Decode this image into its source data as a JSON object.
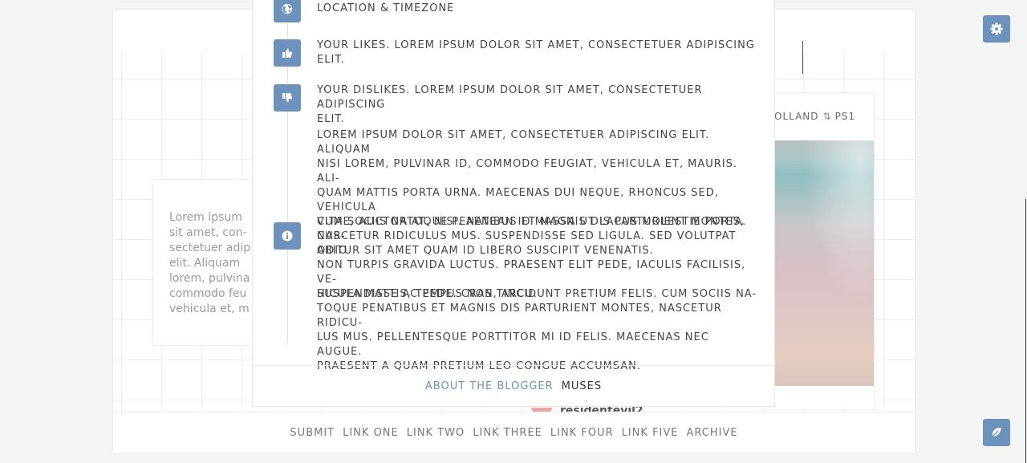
{
  "colors": {
    "accent": "#6d93bd",
    "text": "#444444",
    "muted": "#777777"
  },
  "background_card": {
    "text": "Lorem ipsum\nsit amet, con-\nsectetuer adip\nelit. Aliquam\nlorem, pulvina\ncommodo feu\nvehicula et, m"
  },
  "post": {
    "meta_location": "OLLAND",
    "meta_reblog_icon": "reblog-icon",
    "meta_source": "PS1",
    "username_fragment": "residentevil2"
  },
  "footer_nav": {
    "links": [
      "SUBMIT",
      "LINK ONE",
      "LINK TWO",
      "LINK THREE",
      "LINK FOUR",
      "LINK FIVE",
      "ARCHIVE"
    ]
  },
  "buttons": {
    "settings_icon": "gear-icon",
    "compose_icon": "leaf-icon"
  },
  "about_modal": {
    "sections": [
      {
        "icon": "globe-icon",
        "text": "LOCATION & TIMEZONE"
      },
      {
        "icon": "thumbs-up-icon",
        "text": "YOUR LIKES. LOREM IPSUM DOLOR SIT AMET, CONSECTETUER ADIPISCING\nELIT."
      },
      {
        "icon": "thumbs-down-icon",
        "text": "YOUR DISLIKES. LOREM IPSUM DOLOR SIT AMET, CONSECTETUER ADIPISCING\nELIT."
      },
      {
        "icon": "",
        "text": "LOREM IPSUM DOLOR SIT AMET, CONSECTETUER ADIPISCING ELIT. ALIQUAM\nNISI LOREM, PULVINAR ID, COMMODO FEUGIAT, VEHICULA ET, MAURIS. ALI-\nQUAM MATTIS PORTA URNA. MAECENAS DUI NEQUE, RHONCUS SED, VEHICULA\nVITAE, AUCTOR AT, NISI. AENEAN ID MASSA UT LACUS MOLESTIE PORTA. CUR-\nABITUR SIT AMET QUAM ID LIBERO SUSCIPIT VENENATIS."
      },
      {
        "icon": "info-icon",
        "text": "CUM SOCIIS NATOQUE PENATIBUS ET MAGNIS DIS PARTURIENT MONTES,\nNASCETUR RIDICULUS MUS. SUSPENDISSE SED LIGULA. SED VOLUTPAT ODIO\nNON TURPIS GRAVIDA LUCTUS. PRAESENT ELIT PEDE, IACULIS FACILISIS, VE-\nHICULA MATTIS, TEMPUS NON, ARCU."
      },
      {
        "icon": "",
        "text": "SUSPENDISSE AC PEDE. CRAS TINCIDUNT PRETIUM FELIS. CUM SOCIIS NA-\nTOQUE PENATIBUS ET MAGNIS DIS PARTURIENT MONTES, NASCETUR RIDICU-\nLUS MUS. PELLENTESQUE PORTTITOR MI ID FELIS. MAECENAS NEC AUGUE.\nPRAESENT A QUAM PRETIUM LEO CONGUE ACCUMSAN."
      }
    ],
    "tabs": [
      "ABOUT THE BLOGGER",
      "MUSES"
    ],
    "active_tab": "ABOUT THE BLOGGER"
  }
}
